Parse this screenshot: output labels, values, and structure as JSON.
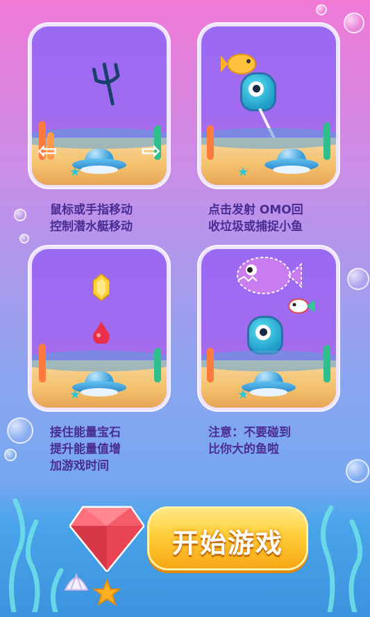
{
  "instructions": [
    {
      "caption": "鼠标或手指移动\n控制潜水艇移动"
    },
    {
      "caption": "点击发射 OMO回\n收垃圾或捕捉小鱼"
    },
    {
      "caption": "接住能量宝石\n提升能量值增\n加游戏时间"
    },
    {
      "caption": "注意：不要碰到\n比你大的鱼啦"
    }
  ],
  "start_button": {
    "label": "开始游戏"
  },
  "colors": {
    "accent_purple": "#9b6af3",
    "button_yellow": "#ffcf3a",
    "caption": "#4a2d93"
  },
  "icons": [
    "trident-icon",
    "arrow-left-icon",
    "arrow-right-icon",
    "ufo-submarine-icon",
    "monster-omo-icon",
    "yellow-fish-icon",
    "gem-icon",
    "red-drop-icon",
    "big-fish-icon",
    "small-fish-icon",
    "ruby-gem-icon",
    "starfish-icon",
    "shell-icon"
  ]
}
